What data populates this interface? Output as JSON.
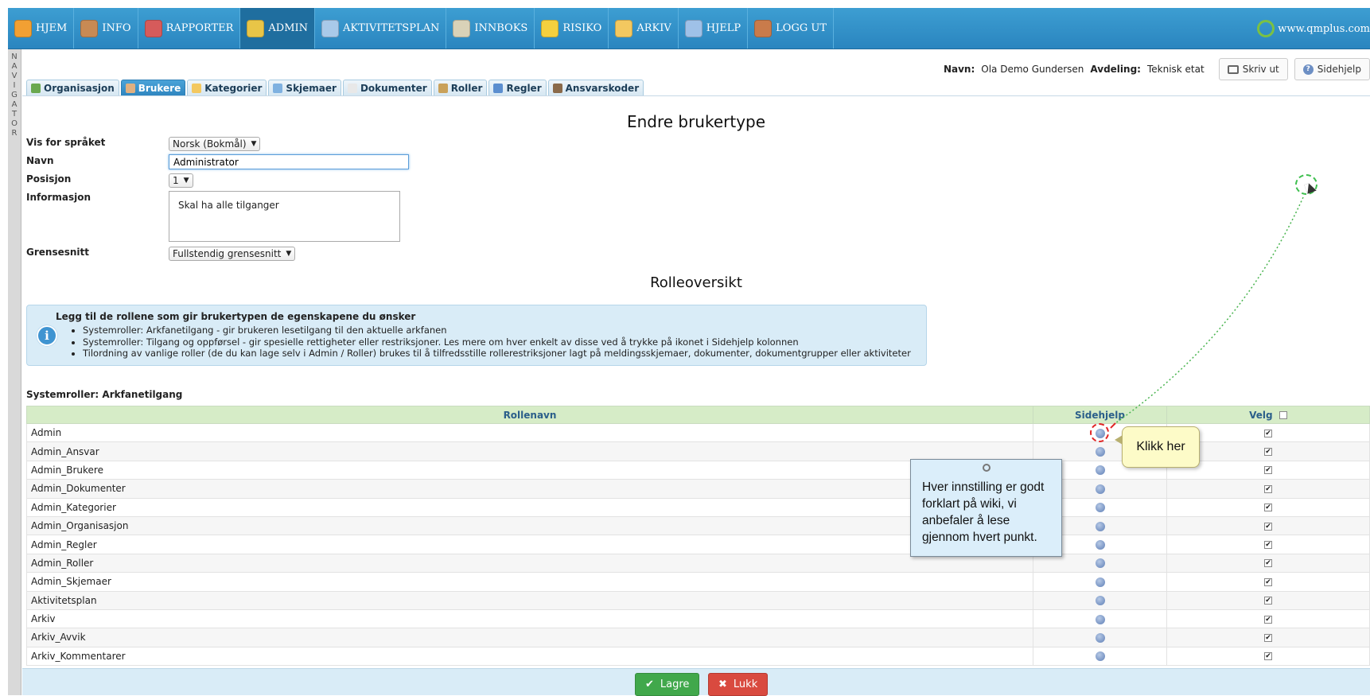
{
  "colors": {
    "nav_bg": "#2a85bf",
    "subtab_active": "#2f86c0",
    "table_header_bg": "#d6ecc7",
    "info_bg": "#d9ecf7",
    "save_btn": "#41a84b",
    "close_btn": "#d94a3f",
    "tooltip_yellow": "#fdfbc8",
    "tooltip_blue": "#dbeefa"
  },
  "topnav": {
    "items": [
      {
        "label": "HJEM",
        "icon": "home-icon",
        "color": "#f2a033"
      },
      {
        "label": "INFO",
        "icon": "info-columns-icon",
        "color": "#c88a54"
      },
      {
        "label": "RAPPORTER",
        "icon": "reports-chart-icon",
        "color": "#d65b5b"
      },
      {
        "label": "ADMIN",
        "icon": "admin-gear-icon",
        "color": "#e8c547"
      },
      {
        "label": "AKTIVITETSPLAN",
        "icon": "calendar-icon",
        "color": "#a9c9e9"
      },
      {
        "label": "INNBOKS",
        "icon": "inbox-icon",
        "color": "#d9d2b8"
      },
      {
        "label": "RISIKO",
        "icon": "warning-icon",
        "color": "#f4d03f"
      },
      {
        "label": "ARKIV",
        "icon": "folder-icon",
        "color": "#f3c860"
      },
      {
        "label": "HJELP",
        "icon": "help-icon",
        "color": "#9fc1e8"
      },
      {
        "label": "LOGG UT",
        "icon": "logout-door-icon",
        "color": "#c97b4b"
      }
    ],
    "brand": "www.qmplus.com"
  },
  "navigator_label": [
    "N",
    "A",
    "V",
    "I",
    "G",
    "A",
    "T",
    "O",
    "R"
  ],
  "userline": {
    "name_label": "Navn:",
    "name_value": "Ola Demo Gundersen",
    "dept_label": "Avdeling:",
    "dept_value": "Teknisk etat",
    "print_label": "Skriv ut",
    "help_label": "Sidehjelp"
  },
  "subtabs": [
    {
      "label": "Organisasjon",
      "icon": "organization-icon",
      "color": "#6aa84f"
    },
    {
      "label": "Brukere",
      "icon": "users-icon",
      "color": "#e0b080"
    },
    {
      "label": "Kategorier",
      "icon": "categories-icon",
      "color": "#f3c860"
    },
    {
      "label": "Skjemaer",
      "icon": "forms-icon",
      "color": "#7fb1e0"
    },
    {
      "label": "Dokumenter",
      "icon": "documents-icon",
      "color": "#e8e8e8"
    },
    {
      "label": "Roller",
      "icon": "roles-icon",
      "color": "#c9a15a"
    },
    {
      "label": "Regler",
      "icon": "rules-wrench-icon",
      "color": "#5b8ecf"
    },
    {
      "label": "Ansvarskoder",
      "icon": "responsibility-icon",
      "color": "#8a6a4a"
    }
  ],
  "page_title": "Endre brukertype",
  "form": {
    "language_label": "Vis for språket",
    "language_value": "Norsk (Bokmål)",
    "name_label": "Navn",
    "name_value": "Administrator",
    "position_label": "Posisjon",
    "position_value": "1",
    "info_label": "Informasjon",
    "info_value": "Skal ha alle tilganger",
    "interface_label": "Grensesnitt",
    "interface_value": "Fullstendig grensesnitt"
  },
  "roles_title": "Rolleoversikt",
  "infobox": {
    "title": "Legg til de rollene som gir brukertypen de egenskapene du ønsker",
    "bullets": [
      "Systemroller: Arkfanetilgang - gir brukeren lesetilgang til den aktuelle arkfanen",
      "Systemroller: Tilgang og oppførsel - gir spesielle rettigheter eller restriksjoner. Les mere om hver enkelt av disse ved å trykke på ikonet i Sidehjelp kolonnen",
      "Tilordning av vanlige roller (de du kan lage selv i Admin / Roller) brukes til å tilfredsstille rollerestriksjoner lagt på meldingsskjemaer, dokumenter, dokumentgrupper eller aktiviteter"
    ]
  },
  "section_title": "Systemroller: Arkfanetilgang",
  "table": {
    "headers": {
      "name": "Rollenavn",
      "help": "Sidehjelp",
      "select": "Velg"
    },
    "rows": [
      {
        "name": "Admin",
        "checked": true
      },
      {
        "name": "Admin_Ansvar",
        "checked": true
      },
      {
        "name": "Admin_Brukere",
        "checked": true
      },
      {
        "name": "Admin_Dokumenter",
        "checked": true
      },
      {
        "name": "Admin_Kategorier",
        "checked": true
      },
      {
        "name": "Admin_Organisasjon",
        "checked": true
      },
      {
        "name": "Admin_Regler",
        "checked": true
      },
      {
        "name": "Admin_Roller",
        "checked": true
      },
      {
        "name": "Admin_Skjemaer",
        "checked": true
      },
      {
        "name": "Aktivitetsplan",
        "checked": true
      },
      {
        "name": "Arkiv",
        "checked": true
      },
      {
        "name": "Arkiv_Avvik",
        "checked": true
      },
      {
        "name": "Arkiv_Kommentarer",
        "checked": true
      }
    ]
  },
  "buttons": {
    "save": "Lagre",
    "close": "Lukk"
  },
  "tooltips": {
    "click_here": "Klikk her",
    "wiki_note": "Hver innstilling er godt forklart på wiki, vi anbefaler å lese gjennom hvert punkt."
  }
}
